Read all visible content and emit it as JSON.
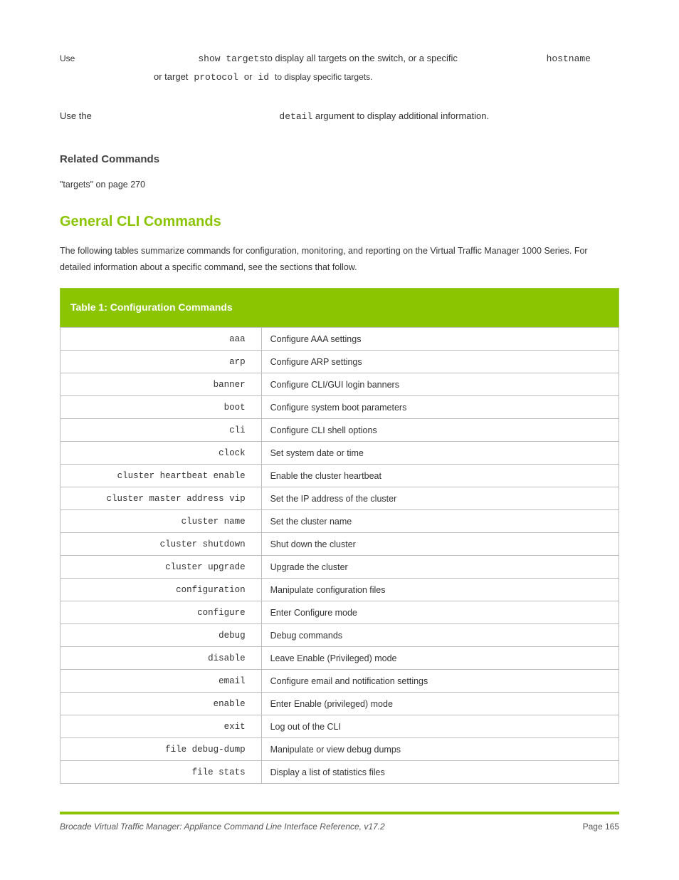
{
  "syntax": {
    "cmd": "show targets",
    "text1": " to display all targets on the switch, or a specific ",
    "hostname": "hostname",
    "text2": "or target ",
    "protocol": "protocol",
    "text3": " or ",
    "id": "id",
    "text4": " to display specific targets."
  },
  "detail": {
    "prefix": "Use the ",
    "kw": "detail",
    "suffix": " argument to display additional information."
  },
  "related": {
    "title": "Related Commands",
    "link": "\"targets\" on page 270"
  },
  "section": {
    "heading": "General CLI Commands",
    "lead": "The following tables summarize commands for configuration, monitoring, and reporting on the Virtual Traffic Manager 1000 Series. For detailed information about a specific command, see the sections that follow."
  },
  "table": {
    "header": "Table 1: Configuration Commands",
    "rows": [
      {
        "cmd": "aaa",
        "desc": "Configure AAA settings"
      },
      {
        "cmd": "arp",
        "desc": "Configure ARP settings"
      },
      {
        "cmd": "banner",
        "desc": "Configure CLI/GUI login banners"
      },
      {
        "cmd": "boot",
        "desc": "Configure system boot parameters"
      },
      {
        "cmd": "cli",
        "desc": "Configure CLI shell options"
      },
      {
        "cmd": "clock",
        "desc": "Set system date or time"
      },
      {
        "cmd": "cluster heartbeat enable",
        "desc": "Enable the cluster heartbeat"
      },
      {
        "cmd": "cluster master address vip",
        "desc": "Set the IP address of the cluster"
      },
      {
        "cmd": "cluster name",
        "desc": "Set the cluster name"
      },
      {
        "cmd": "cluster shutdown",
        "desc": "Shut down the cluster"
      },
      {
        "cmd": "cluster upgrade",
        "desc": "Upgrade the cluster"
      },
      {
        "cmd": "configuration",
        "desc": "Manipulate configuration files"
      },
      {
        "cmd": "configure",
        "desc": "Enter Configure mode"
      },
      {
        "cmd": "debug",
        "desc": "Debug commands"
      },
      {
        "cmd": "disable",
        "desc": "Leave Enable (Privileged) mode"
      },
      {
        "cmd": "email",
        "desc": "Configure email and notification settings"
      },
      {
        "cmd": "enable",
        "desc": "Enter Enable (privileged) mode"
      },
      {
        "cmd": "exit",
        "desc": "Log out of the CLI"
      },
      {
        "cmd": "file debug-dump",
        "desc": "Manipulate or view debug dumps"
      },
      {
        "cmd": "file stats",
        "desc": "Display a list of statistics files"
      }
    ]
  },
  "footer": {
    "left": "Brocade Virtual Traffic Manager: Appliance Command Line Interface Reference, v17.2",
    "right": "Page 165"
  }
}
